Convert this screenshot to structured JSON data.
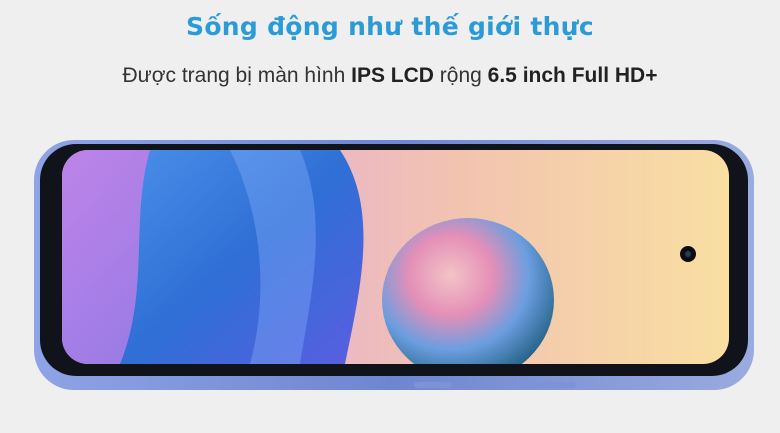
{
  "headline": "Sống động như thế giới thực",
  "subtitle": {
    "part1": "Được trang bị màn hình ",
    "bold1": "IPS LCD",
    "part2": " rộng ",
    "bold2": "6.5 inch Full HD+"
  },
  "colors": {
    "page_background": "#efefef",
    "headline": "#2a9bd6",
    "subtitle_text": "#333333",
    "phone_frame": "#6f86cf",
    "phone_bezel": "#0d0f14"
  },
  "icons": {
    "camera": "punch-hole-camera-icon"
  }
}
